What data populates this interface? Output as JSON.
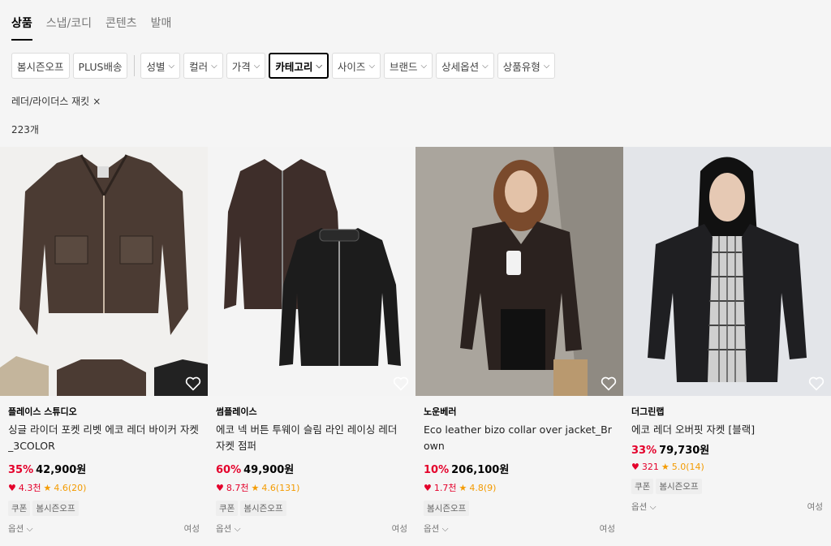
{
  "tabs": [
    {
      "label": "상품",
      "active": true
    },
    {
      "label": "스냅/코디",
      "active": false
    },
    {
      "label": "콘텐츠",
      "active": false
    },
    {
      "label": "발매",
      "active": false
    }
  ],
  "filters": {
    "quick": [
      "봄시즌오프",
      "PLUS배송"
    ],
    "dropdowns": [
      "성별",
      "컬러",
      "가격",
      "카테고리",
      "사이즈",
      "브랜드",
      "상세옵션",
      "상품유형"
    ],
    "selected": "카테고리"
  },
  "applied_filter": "레더/라이더스 재킷",
  "applied_remove": "×",
  "result_count": "223개",
  "products": [
    {
      "brand": "플레이스 스튜디오",
      "name": "싱글 라이더 포켓 리벳 에코 레더 바이커 자켓_3COLOR",
      "discount": "35%",
      "price": "42,900원",
      "likes": "4.3천",
      "rating": "4.6(20)",
      "tags": [
        "쿠폰",
        "봄시즌오프"
      ],
      "option": "옵션",
      "gender": "여성"
    },
    {
      "brand": "썸플레이스",
      "name": "에코 넥 버튼 투웨이 슬림 라인 레이싱 레더 자켓 점퍼",
      "discount": "60%",
      "price": "49,900원",
      "likes": "8.7천",
      "rating": "4.6(131)",
      "tags": [
        "쿠폰",
        "봄시즌오프"
      ],
      "option": "옵션",
      "gender": "여성"
    },
    {
      "brand": "노운베러",
      "name": "Eco leather bizo collar over jacket_Brown",
      "discount": "10%",
      "price": "206,100원",
      "likes": "1.7천",
      "rating": "4.8(9)",
      "tags": [
        "봄시즌오프"
      ],
      "option": "옵션",
      "gender": "여성"
    },
    {
      "brand": "더그린랩",
      "name": "에코 레더 오버핏 자켓 [블랙]",
      "discount": "33%",
      "price": "79,730원",
      "likes": "321",
      "rating": "5.0(14)",
      "tags": [
        "쿠폰",
        "봄시즌오프"
      ],
      "option": "옵션",
      "gender": "여성"
    }
  ],
  "colors": {
    "discount": "#e4002b",
    "rating": "#f49b00",
    "background": "#f5f5f5"
  }
}
